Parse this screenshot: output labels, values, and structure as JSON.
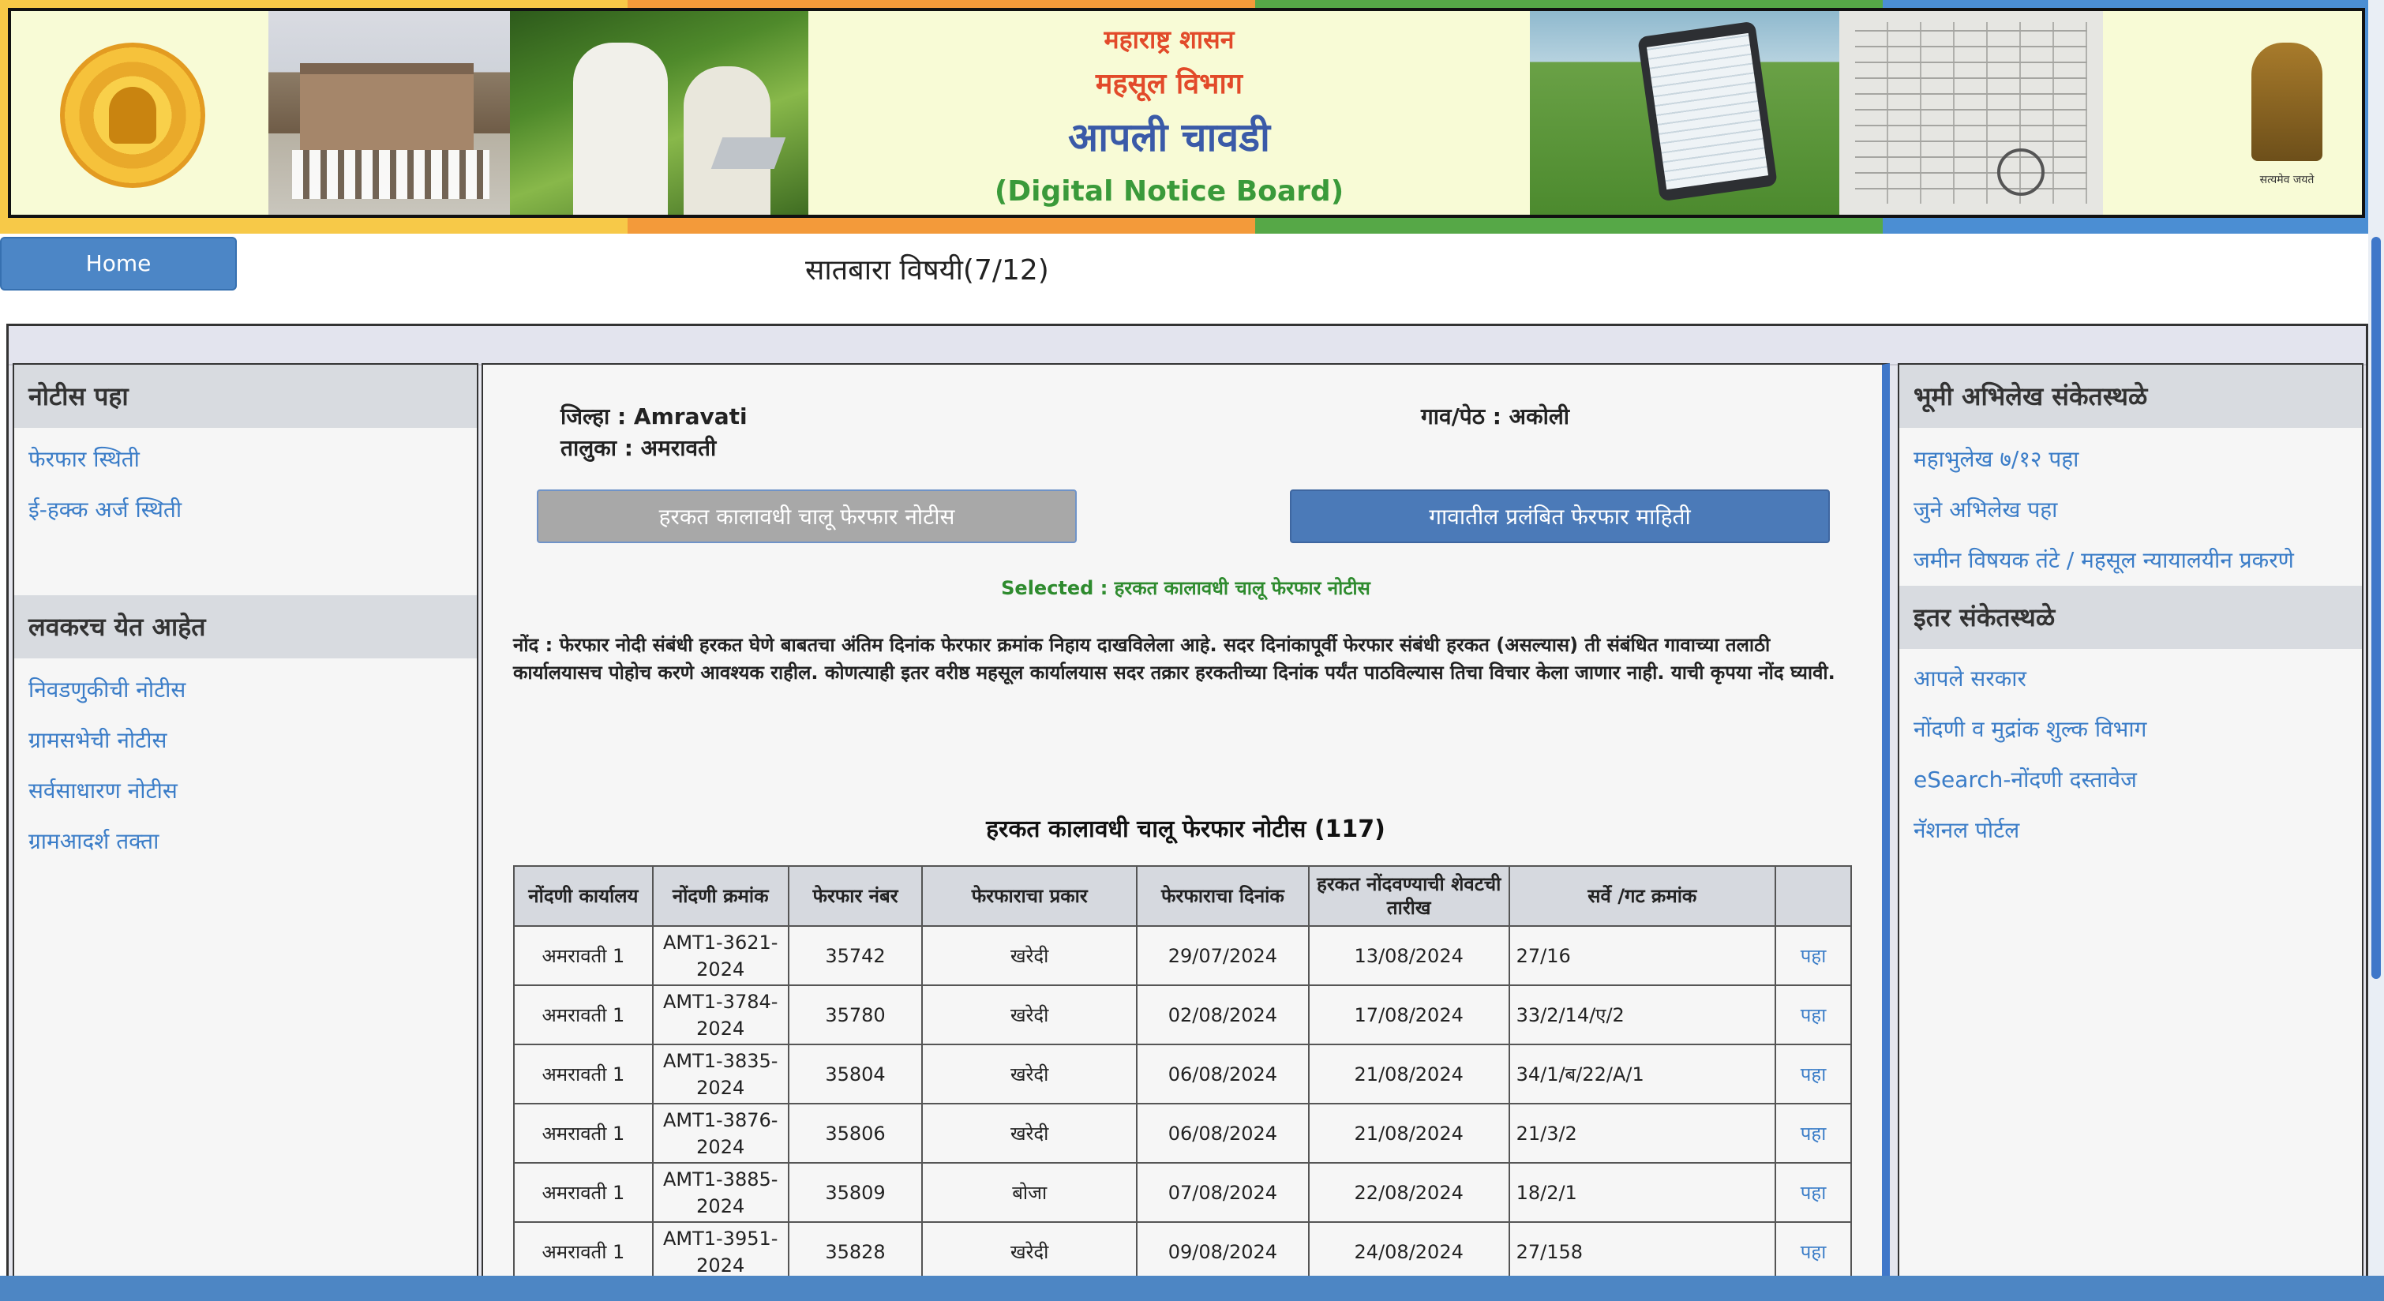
{
  "header": {
    "line1": "महाराष्ट्र शासन",
    "line2": "महसूल विभाग",
    "line3": "आपली चावडी",
    "line4": "(Digital Notice Board)",
    "emblem_motto": "सत्यमेव जयते"
  },
  "nav": {
    "home_label": "Home",
    "page_heading": "सातबारा विषयी(7/12)"
  },
  "left_sidebar": {
    "section1_title": "नोटीस पहा",
    "section1_links": [
      "फेरफार स्थिती",
      "ई-हक्क अर्ज स्थिती"
    ],
    "section2_title": "लवकरच येत आहेत",
    "section2_links": [
      "निवडणुकीची नोटीस",
      "ग्रामसभेची नोटीस",
      "सर्वसाधारण नोटीस",
      "ग्रामआदर्श तक्ता"
    ]
  },
  "right_sidebar": {
    "section1_title": "भूमी अभिलेख संकेतस्थळे",
    "section1_links": [
      "महाभुलेख ७/१२ पहा",
      "जुने अभिलेख पहा",
      "जमीन विषयक तंटे / महसूल न्यायालयीन प्रकरणे"
    ],
    "section2_title": "इतर संकेतस्थळे",
    "section2_links": [
      "आपले सरकार",
      "नोंदणी व मुद्रांक शुल्क विभाग",
      "eSearch-नोंदणी दस्तावेज",
      "नॅशनल पोर्टल"
    ]
  },
  "location": {
    "district": "जिल्हा : Amravati",
    "taluka": "तालुका : अमरावती",
    "village": "गाव/पेठ : अकोली"
  },
  "tabs": {
    "active_notice": "हरकत कालावधी चालू फेरफार नोटीस",
    "pending_info": "गावातील प्रलंबित फेरफार माहिती"
  },
  "selected_note": "Selected : हरकत कालावधी चालू फेरफार नोटीस",
  "disclaimer": "नोंद : फेरफार नोदी संबंधी हरकत घेणे बाबतचा अंतिम दिनांक फेरफार क्रमांक निहाय दाखविलेला आहे. सदर दिनांकापूर्वी फेरफार संबंधी हरकत (असल्यास) ती संबंधित गावाच्या तलाठी कार्यालयासच पोहोच करणे आवश्यक राहील. कोणत्याही इतर वरीष्ठ महसूल कार्यालयास सदर तक्रार हरकतीच्या दिनांक पर्यंत पाठविल्यास तिचा विचार केला जाणार नाही. याची कृपया नोंद घ्यावी.",
  "table": {
    "title": "हरकत कालावधी चालू फेरफार नोटीस (117)",
    "headers": [
      "नोंदणी कार्यालय",
      "नोंदणी क्रमांक",
      "फेरफार नंबर",
      "फेरफाराचा प्रकार",
      "फेरफाराचा दिनांक",
      "हरकत नोंदवण्याची शेवटची तारीख",
      "सर्वे /गट क्रमांक",
      ""
    ],
    "rows": [
      [
        "अमरावती 1",
        "AMT1-3621-2024",
        "35742",
        "खरेदी",
        "29/07/2024",
        "13/08/2024",
        "27/16",
        "पहा"
      ],
      [
        "अमरावती 1",
        "AMT1-3784-2024",
        "35780",
        "खरेदी",
        "02/08/2024",
        "17/08/2024",
        "33/2/14/ए/2",
        "पहा"
      ],
      [
        "अमरावती 1",
        "AMT1-3835-2024",
        "35804",
        "खरेदी",
        "06/08/2024",
        "21/08/2024",
        "34/1/ब/22/A/1",
        "पहा"
      ],
      [
        "अमरावती 1",
        "AMT1-3876-2024",
        "35806",
        "खरेदी",
        "06/08/2024",
        "21/08/2024",
        "21/3/2",
        "पहा"
      ],
      [
        "अमरावती 1",
        "AMT1-3885-2024",
        "35809",
        "बोजा",
        "07/08/2024",
        "22/08/2024",
        "18/2/1",
        "पहा"
      ],
      [
        "अमरावती 1",
        "AMT1-3951-2024",
        "35828",
        "खरेदी",
        "09/08/2024",
        "24/08/2024",
        "27/158",
        "पहा"
      ]
    ]
  }
}
